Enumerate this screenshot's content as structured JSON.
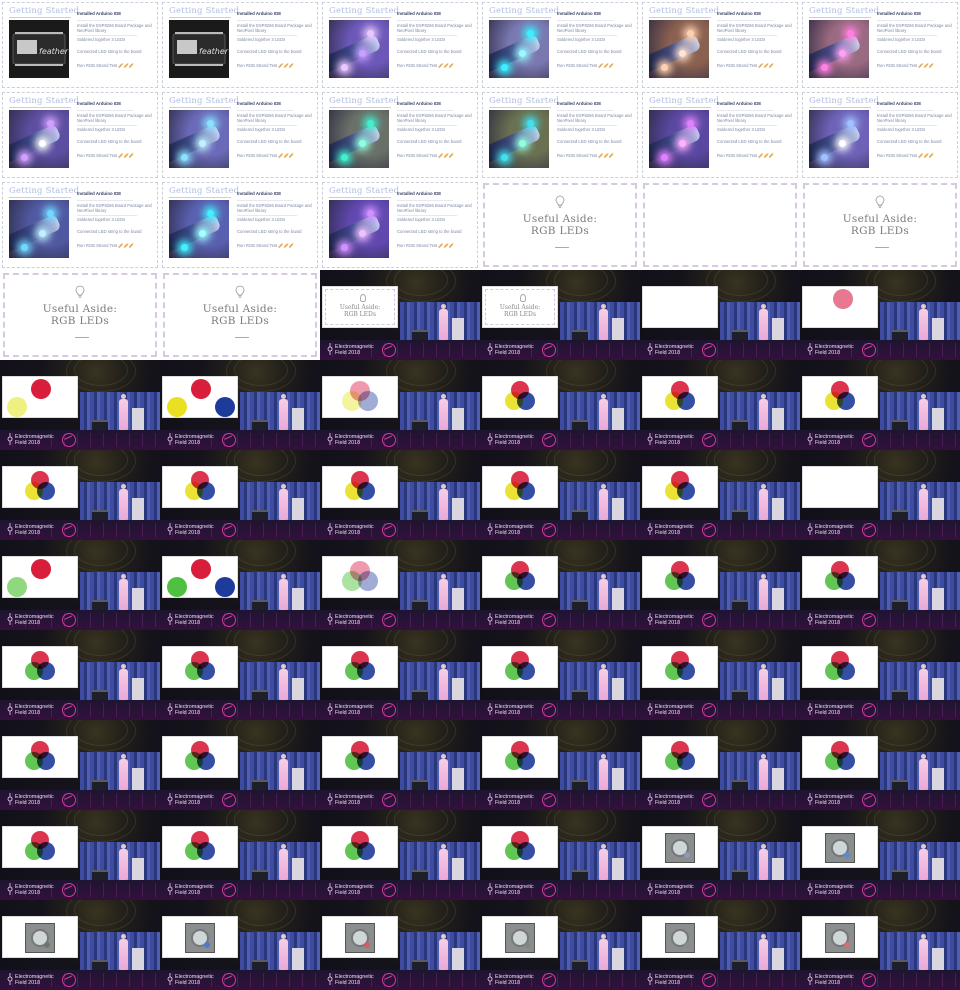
{
  "getting_started": {
    "title": "Getting Started",
    "checklist_title": "Installed Arduino IDE",
    "items": [
      "Install the ESP8266 Board Package and NeoPixel library",
      "Soldered together 3 LEDs",
      "Connected LED string to the board",
      "Run RGB Strand Test"
    ],
    "emoji": "🥖🥖🥖"
  },
  "aside": {
    "line1": "Useful Aside:",
    "line2": "RGB LEDs"
  },
  "event": {
    "name_line1": "Electromagnetic",
    "name_line2": "Field 2018"
  },
  "tiles": [
    {
      "kind": "gs",
      "photo": "board"
    },
    {
      "kind": "gs",
      "photo": "board"
    },
    {
      "kind": "gs",
      "photo": "led",
      "bg": "#6c58b8",
      "leds": [
        "#e8c8ff",
        "#c8a0ff"
      ]
    },
    {
      "kind": "gs",
      "photo": "led",
      "bg": "#7a78b0",
      "leds": [
        "#3af0ff",
        "#9af8ff"
      ]
    },
    {
      "kind": "gs",
      "photo": "led",
      "bg": "#8a6050",
      "leds": [
        "#ffd0b0",
        "#ffe4d0"
      ]
    },
    {
      "kind": "gs",
      "photo": "led",
      "bg": "#9a6a80",
      "leds": [
        "#ff80e0",
        "#ffa0f0"
      ]
    },
    {
      "kind": "gs",
      "photo": "led",
      "bg": "#5c4ea0",
      "leds": [
        "#d0a0ff",
        "#ffffff"
      ]
    },
    {
      "kind": "gs",
      "photo": "led",
      "bg": "#6a6ab8",
      "leds": [
        "#8ae0ff",
        "#c0f0ff"
      ]
    },
    {
      "kind": "gs",
      "photo": "led",
      "bg": "#6a7068",
      "leds": [
        "#40f0d0",
        "#90ffe0"
      ]
    },
    {
      "kind": "gs",
      "photo": "led",
      "bg": "#6a7050",
      "leds": [
        "#40e0f0",
        "#90ffe0"
      ]
    },
    {
      "kind": "gs",
      "photo": "led",
      "bg": "#5a48a0",
      "leds": [
        "#e080ff",
        "#ffb0ff"
      ]
    },
    {
      "kind": "gs",
      "photo": "led",
      "bg": "#6e62b8",
      "leds": [
        "#a0c0ff",
        "#ffffff"
      ]
    },
    {
      "kind": "gs",
      "photo": "led",
      "bg": "#5058a0",
      "leds": [
        "#70d8ff",
        "#c0f0ff"
      ]
    },
    {
      "kind": "gs",
      "photo": "led",
      "bg": "#5a60b0",
      "leds": [
        "#40f0ff",
        "#a0ffff"
      ]
    },
    {
      "kind": "gs",
      "photo": "led",
      "bg": "#6048b0",
      "leds": [
        "#d090ff",
        "#f0c0ff"
      ]
    },
    {
      "kind": "aside"
    },
    {
      "kind": "aside_empty"
    },
    {
      "kind": "aside"
    },
    {
      "kind": "aside"
    },
    {
      "kind": "aside"
    },
    {
      "kind": "stage",
      "slide": "aside"
    },
    {
      "kind": "stage",
      "slide": "aside"
    },
    {
      "kind": "stage",
      "slide": "blank"
    },
    {
      "kind": "stage",
      "slide": "r1"
    },
    {
      "kind": "stage",
      "slide": "ry"
    },
    {
      "kind": "stage",
      "slide": "ryb"
    },
    {
      "kind": "stage",
      "slide": "ryb_merge"
    },
    {
      "kind": "stage",
      "slide": "ryb_full"
    },
    {
      "kind": "stage",
      "slide": "ryb_full"
    },
    {
      "kind": "stage",
      "slide": "ryb_full"
    },
    {
      "kind": "stage",
      "slide": "ryb_full"
    },
    {
      "kind": "stage",
      "slide": "ryb_full"
    },
    {
      "kind": "stage",
      "slide": "ryb_full"
    },
    {
      "kind": "stage",
      "slide": "ryb_full"
    },
    {
      "kind": "stage",
      "slide": "ryb_full"
    },
    {
      "kind": "stage",
      "slide": "blank"
    },
    {
      "kind": "stage",
      "slide": "rg"
    },
    {
      "kind": "stage",
      "slide": "rgb"
    },
    {
      "kind": "stage",
      "slide": "rgb_merge"
    },
    {
      "kind": "stage",
      "slide": "rgb_full"
    },
    {
      "kind": "stage",
      "slide": "rgb_full"
    },
    {
      "kind": "stage",
      "slide": "rgb_full"
    },
    {
      "kind": "stage",
      "slide": "rgb_full"
    },
    {
      "kind": "stage",
      "slide": "rgb_full"
    },
    {
      "kind": "stage",
      "slide": "rgb_full"
    },
    {
      "kind": "stage",
      "slide": "rgb_full"
    },
    {
      "kind": "stage",
      "slide": "rgb_full"
    },
    {
      "kind": "stage",
      "slide": "rgb_full"
    },
    {
      "kind": "stage",
      "slide": "rgb_full"
    },
    {
      "kind": "stage",
      "slide": "rgb_full"
    },
    {
      "kind": "stage",
      "slide": "rgb_full"
    },
    {
      "kind": "stage",
      "slide": "rgb_full"
    },
    {
      "kind": "stage",
      "slide": "rgb_full"
    },
    {
      "kind": "stage",
      "slide": "rgb_full"
    },
    {
      "kind": "stage",
      "slide": "rgb_full"
    },
    {
      "kind": "stage",
      "slide": "rgb_full"
    },
    {
      "kind": "stage",
      "slide": "rgb_full"
    },
    {
      "kind": "stage",
      "slide": "rgb_full"
    },
    {
      "kind": "stage",
      "slide": "led",
      "dot": "#8a9ab0"
    },
    {
      "kind": "stage",
      "slide": "led",
      "dot": "#5a8ad0"
    },
    {
      "kind": "stage",
      "slide": "led",
      "dot": "#6a7a6a"
    },
    {
      "kind": "stage",
      "slide": "led",
      "dot": "#4a7ad0"
    },
    {
      "kind": "stage",
      "slide": "led",
      "dot": "#d06060"
    },
    {
      "kind": "stage",
      "slide": "led",
      "dot": "#7a8a7a"
    },
    {
      "kind": "stage",
      "slide": "led",
      "dot": "#8a8a8a"
    },
    {
      "kind": "stage",
      "slide": "led",
      "dot": "#d07070"
    }
  ],
  "colors": {
    "red": "#d81e3a",
    "yellow": "#e8e020",
    "blue": "#1e3a9a",
    "green": "#50c040",
    "pale_yellow": "#f0f080",
    "pale_green": "#90d880",
    "pale_red": "#e87890"
  }
}
